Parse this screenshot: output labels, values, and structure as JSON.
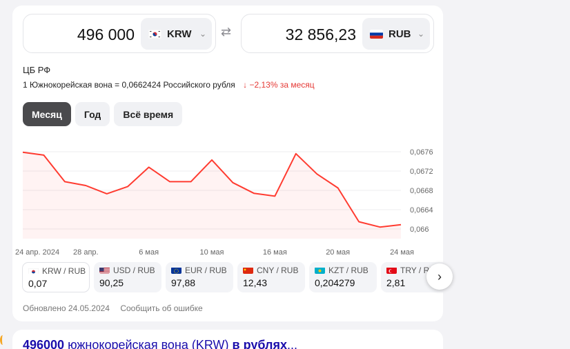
{
  "converter": {
    "from": {
      "amount": "496 000",
      "code": "KRW",
      "flag": "korea-flag-icon"
    },
    "to": {
      "amount": "32 856,23",
      "code": "RUB",
      "flag": "russia-flag-icon"
    },
    "swap_icon": "swap-arrows-icon"
  },
  "info": {
    "source": "ЦБ РФ",
    "rate_text": "1 Южнокорейская вона = 0,0662424 Российского рубля",
    "change": "−2,13%",
    "period": "за месяц",
    "change_color": "#e53935"
  },
  "tabs": [
    {
      "label": "Месяц",
      "active": true
    },
    {
      "label": "Год",
      "active": false
    },
    {
      "label": "Всё время",
      "active": false
    }
  ],
  "chart_data": {
    "type": "line",
    "x_labels": [
      "24 апр. 2024",
      "28 апр.",
      "6 мая",
      "10 мая",
      "16 мая",
      "20 мая",
      "24 мая"
    ],
    "y_ticks": [
      "0,0676",
      "0,0672",
      "0,0668",
      "0,0664",
      "0,066"
    ],
    "ylim": [
      0.0658,
      0.0678
    ],
    "series": [
      {
        "values": [
          0.06759,
          0.06753,
          0.06698,
          0.0669,
          0.06673,
          0.06688,
          0.06728,
          0.06698,
          0.06698,
          0.06743,
          0.06696,
          0.06674,
          0.06668,
          0.06756,
          0.06714,
          0.06685,
          0.06615,
          0.06604,
          0.06609
        ]
      }
    ],
    "line_color": "#ff3b30",
    "grid": true
  },
  "pairs": [
    {
      "label": "KRW / RUB",
      "value": "0,07",
      "flag": "korea-flag-icon",
      "active": true
    },
    {
      "label": "USD / RUB",
      "value": "90,25",
      "flag": "usa-flag-icon",
      "active": false
    },
    {
      "label": "EUR / RUB",
      "value": "97,88",
      "flag": "eu-flag-icon",
      "active": false
    },
    {
      "label": "CNY / RUB",
      "value": "12,43",
      "flag": "china-flag-icon",
      "active": false
    },
    {
      "label": "KZT / RUB",
      "value": "0,204279",
      "flag": "kazakhstan-flag-icon",
      "active": false
    },
    {
      "label": "TRY / RUB",
      "value": "2,81",
      "flag": "turkey-flag-icon",
      "active": false
    }
  ],
  "footer": {
    "updated": "Обновлено 24.05.2024",
    "report": "Сообщить об ошибке"
  },
  "result": {
    "title_number": "496000",
    "title_mid": " южнокорейская вона (KRW) ",
    "title_bold": "в рублях",
    "title_end": "..."
  }
}
